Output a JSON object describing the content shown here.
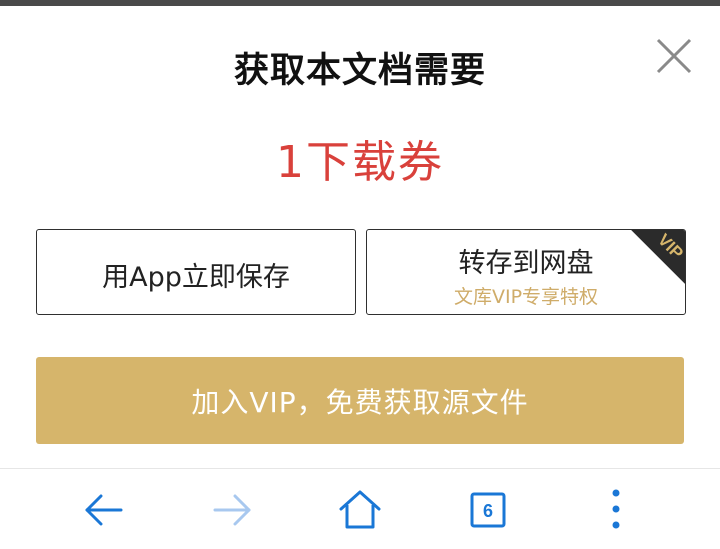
{
  "dialog": {
    "title": "获取本文档需要",
    "price": "1下载券",
    "option_app": {
      "label": "用App立即保存"
    },
    "option_disk": {
      "label": "转存到网盘",
      "sublabel": "文库VIP专享特权",
      "badge": "VIP"
    },
    "cta_label": "加入VIP，免费获取源文件"
  },
  "browser_nav": {
    "tab_count": "6",
    "icons": [
      "back-arrow-icon",
      "forward-arrow-icon",
      "home-icon",
      "tabs-icon",
      "more-menu-icon"
    ]
  },
  "colors": {
    "price": "#d9413b",
    "cta_bg": "#d6b56b",
    "vip_sublabel": "#cfac69",
    "nav_icon_active": "#1a77d6",
    "nav_icon_disabled": "#a8c8ef"
  }
}
